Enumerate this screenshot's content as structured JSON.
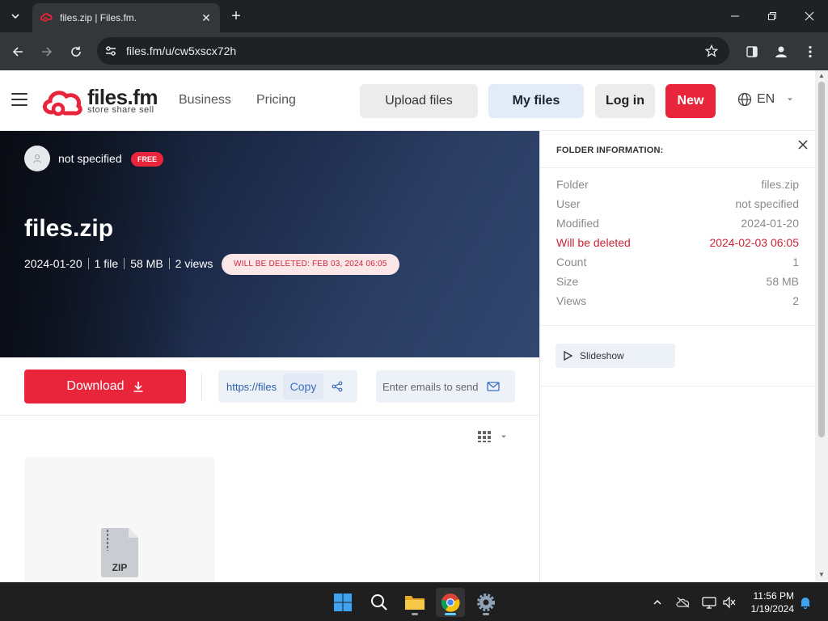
{
  "browser": {
    "tab_title": "files.zip | Files.fm.",
    "url": "files.fm/u/cw5xscx72h"
  },
  "header": {
    "logo_main": "files.fm",
    "logo_tagline": "store share sell",
    "nav": [
      "Business",
      "Pricing"
    ],
    "upload_label": "Upload files",
    "myfiles_label": "My files",
    "login_label": "Log in",
    "new_label": "New",
    "language": "EN"
  },
  "hero": {
    "owner": "not specified",
    "badge": "FREE",
    "title": "files.zip",
    "meta": [
      "2024-01-20",
      "1 file",
      "58 MB",
      "2 views"
    ],
    "delete_notice": "WILL BE DELETED: FEB 03, 2024 06:05"
  },
  "actions": {
    "download_label": "Download",
    "share_link": "https://files",
    "copy_label": "Copy",
    "email_placeholder": "Enter emails to send t"
  },
  "file_card": {
    "ext": "ZIP"
  },
  "side_panel": {
    "heading": "FOLDER INFORMATION:",
    "rows": [
      {
        "k": "Folder",
        "v": "files.zip"
      },
      {
        "k": "User",
        "v": "not specified"
      },
      {
        "k": "Modified",
        "v": "2024-01-20"
      },
      {
        "k": "Will be deleted",
        "v": "2024-02-03 06:05"
      },
      {
        "k": "Count",
        "v": "1"
      },
      {
        "k": "Size",
        "v": "58 MB"
      },
      {
        "k": "Views",
        "v": "2"
      }
    ],
    "slideshow_label": "Slideshow"
  },
  "taskbar": {
    "time": "11:56 PM",
    "date": "1/19/2024"
  },
  "colors": {
    "brand_red": "#e8253a",
    "link_blue": "#2b5fa8",
    "warn_red": "#cc2336"
  }
}
